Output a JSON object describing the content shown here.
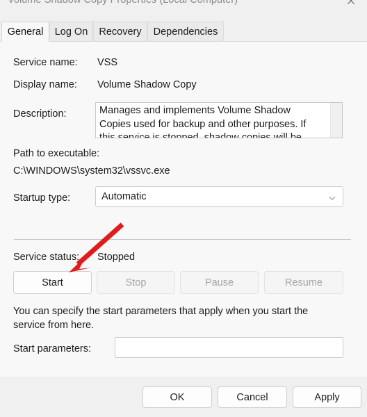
{
  "window": {
    "title": "Volume Shadow Copy Properties (Local Computer)",
    "close_icon": "close-icon"
  },
  "tabs": [
    {
      "label": "General",
      "active": true
    },
    {
      "label": "Log On",
      "active": false
    },
    {
      "label": "Recovery",
      "active": false
    },
    {
      "label": "Dependencies",
      "active": false
    }
  ],
  "general": {
    "service_name_label": "Service name:",
    "service_name_value": "VSS",
    "display_name_label": "Display name:",
    "display_name_value": "Volume Shadow Copy",
    "description_label": "Description:",
    "description_value": "Manages and implements Volume Shadow Copies used for backup and other purposes. If this service is stopped, shadow copies will be unavailable for",
    "path_label": "Path to executable:",
    "path_value": "C:\\WINDOWS\\system32\\vssvc.exe",
    "startup_type_label": "Startup type:",
    "startup_type_value": "Automatic",
    "startup_type_arrow_icon": "chevron-down-icon",
    "service_status_label": "Service status:",
    "service_status_value": "Stopped"
  },
  "service_buttons": [
    {
      "label": "Start",
      "enabled": true
    },
    {
      "label": "Stop",
      "enabled": false
    },
    {
      "label": "Pause",
      "enabled": false
    },
    {
      "label": "Resume",
      "enabled": false
    }
  ],
  "params": {
    "help_text": "You can specify the start parameters that apply when you start the service from here.",
    "label": "Start parameters:",
    "value": "",
    "placeholder": ""
  },
  "footer": {
    "ok_label": "OK",
    "cancel_label": "Cancel",
    "apply_label": "Apply"
  },
  "annotation": {
    "arrow_color": "#e01b1b",
    "description": "red arrow pointing at Start button"
  }
}
